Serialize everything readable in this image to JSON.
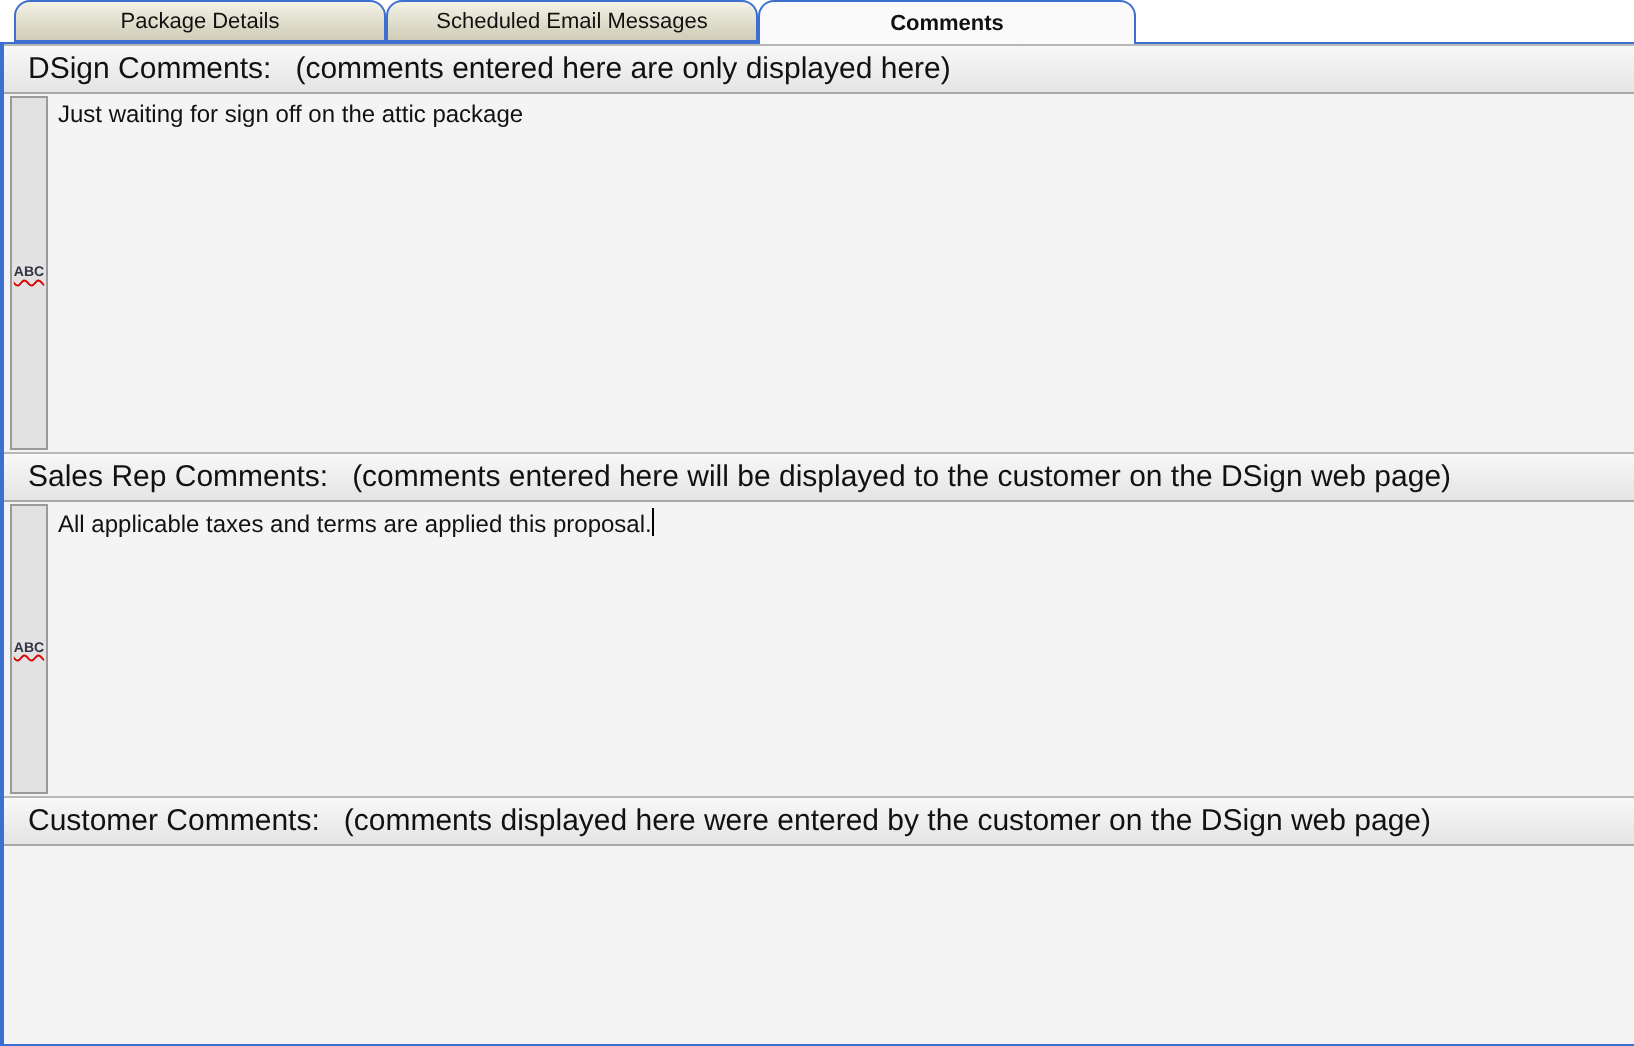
{
  "tabs": [
    {
      "label": "Package Details",
      "selected": false
    },
    {
      "label": "Scheduled Email Messages",
      "selected": false
    },
    {
      "label": "Comments",
      "selected": true
    }
  ],
  "sections": [
    {
      "title": "DSign Comments:",
      "note": "(comments entered here are only displayed here)",
      "value": "Just waiting for sign off on the attic package",
      "spell_button": "ABC",
      "focused": false
    },
    {
      "title": "Sales Rep Comments:",
      "note": "(comments entered here will be displayed to the customer on the DSign web page)",
      "value": "All applicable taxes and terms are applied this proposal.",
      "spell_button": "ABC",
      "focused": true
    },
    {
      "title": "Customer Comments:",
      "note": "(comments displayed here were entered by the customer on the DSign web page)"
    }
  ]
}
